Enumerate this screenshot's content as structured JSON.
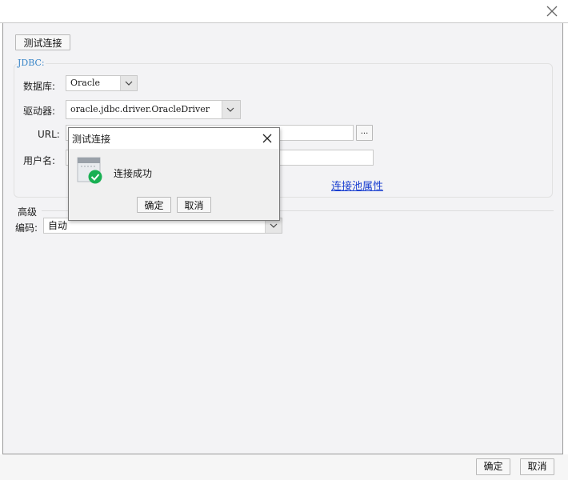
{
  "window": {
    "close_icon": "close-icon"
  },
  "toolbar": {
    "test_connection_label": "测试连接"
  },
  "jdbc": {
    "group_title": "JDBC:",
    "database_label": "数据库:",
    "database_value": "Oracle",
    "driver_label": "驱动器:",
    "driver_value": "oracle.jdbc.driver.OracleDriver",
    "url_label": "URL:",
    "url_value": "",
    "browse_label": "...",
    "username_label": "用户名:",
    "username_value": "",
    "pool_link": "连接池属性"
  },
  "advanced": {
    "title": "高级",
    "encoding_label": "编码:",
    "encoding_value": "自动"
  },
  "footer": {
    "ok_label": "确定",
    "cancel_label": "取消"
  },
  "modal": {
    "title": "测试连接",
    "message": "连接成功",
    "ok_label": "确定",
    "cancel_label": "取消",
    "icon": "success-check-icon",
    "success_color": "#19b053"
  }
}
